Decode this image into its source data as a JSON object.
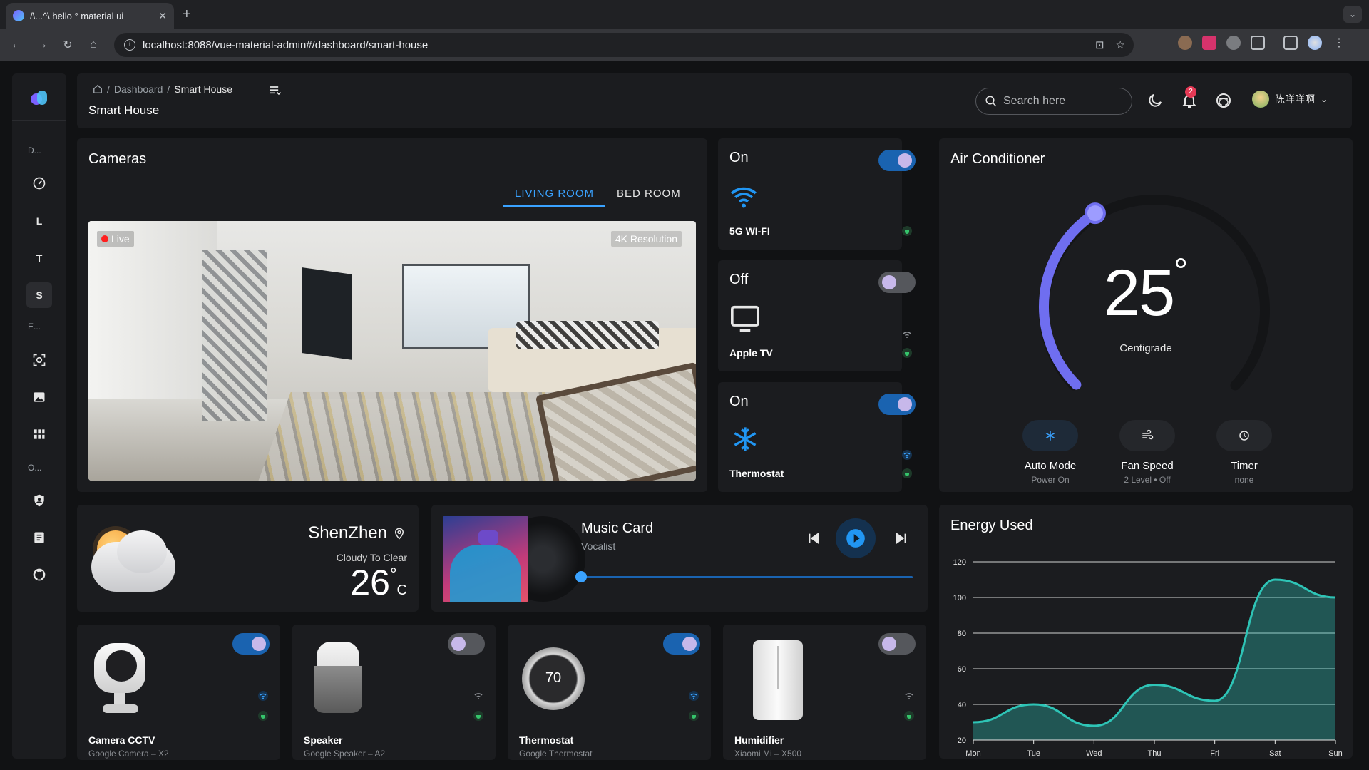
{
  "browser": {
    "tab_title": "/\\...^\\ hello ° material ui",
    "url": "localhost:8088/vue-material-admin#/dashboard/smart-house"
  },
  "sidebar": {
    "sections": [
      "D...",
      "E...",
      "O..."
    ],
    "items": [
      {
        "icon": "gauge-icon"
      },
      {
        "letter": "L"
      },
      {
        "letter": "T"
      },
      {
        "letter": "S"
      },
      {
        "icon": "scan-icon"
      },
      {
        "icon": "image-icon"
      },
      {
        "icon": "grid-icon"
      },
      {
        "icon": "shield-user-icon"
      },
      {
        "icon": "document-icon"
      },
      {
        "icon": "github-icon"
      }
    ]
  },
  "header": {
    "breadcrumb": [
      "Dashboard",
      "Smart House"
    ],
    "page_title": "Smart House",
    "search_placeholder": "Search here",
    "notification_count": "2",
    "username": "陈咩咩啊"
  },
  "cameras": {
    "title": "Cameras",
    "tabs": [
      "LIVING ROOM",
      "BED ROOM"
    ],
    "live_label": "Live",
    "resolution_label": "4K Resolution"
  },
  "devices_side": [
    {
      "state": "On",
      "name": "5G WI-FI",
      "on": true
    },
    {
      "state": "Off",
      "name": "Apple TV",
      "on": false
    },
    {
      "state": "On",
      "name": "Thermostat",
      "on": true
    }
  ],
  "air_conditioner": {
    "title": "Air Conditioner",
    "temperature": "25",
    "degree": "°",
    "unit": "Centigrade",
    "level": 0.38,
    "options": [
      {
        "label": "Auto Mode",
        "sub": "Power On"
      },
      {
        "label": "Fan Speed",
        "sub": "2 Level • Off"
      },
      {
        "label": "Timer",
        "sub": "none"
      }
    ]
  },
  "weather": {
    "city": "ShenZhen",
    "condition": "Cloudy To Clear",
    "temp": "26",
    "deg": "°",
    "unit": "C"
  },
  "music": {
    "title": "Music Card",
    "artist": "Vocalist",
    "progress": 0.0
  },
  "devices_bottom": [
    {
      "name": "Camera CCTV",
      "model": "Google Camera – X2",
      "on": true
    },
    {
      "name": "Speaker",
      "model": "Google Speaker – A2",
      "on": false
    },
    {
      "name": "Thermostat",
      "model": "Google Thermostat",
      "on": true,
      "display": "70"
    },
    {
      "name": "Humidifier",
      "model": "Xiaomi Mi – X500",
      "on": false
    }
  ],
  "chart_data": {
    "type": "area",
    "title": "Energy Used",
    "categories": [
      "Mon",
      "Tue",
      "Wed",
      "Thu",
      "Fri",
      "Sat",
      "Sun"
    ],
    "values": [
      30,
      40,
      28,
      51,
      42,
      110,
      100
    ],
    "ylim": [
      20,
      120
    ],
    "yticks": [
      20,
      40,
      60,
      80,
      100,
      120
    ],
    "color": "#2ec4b6",
    "grid": true
  }
}
